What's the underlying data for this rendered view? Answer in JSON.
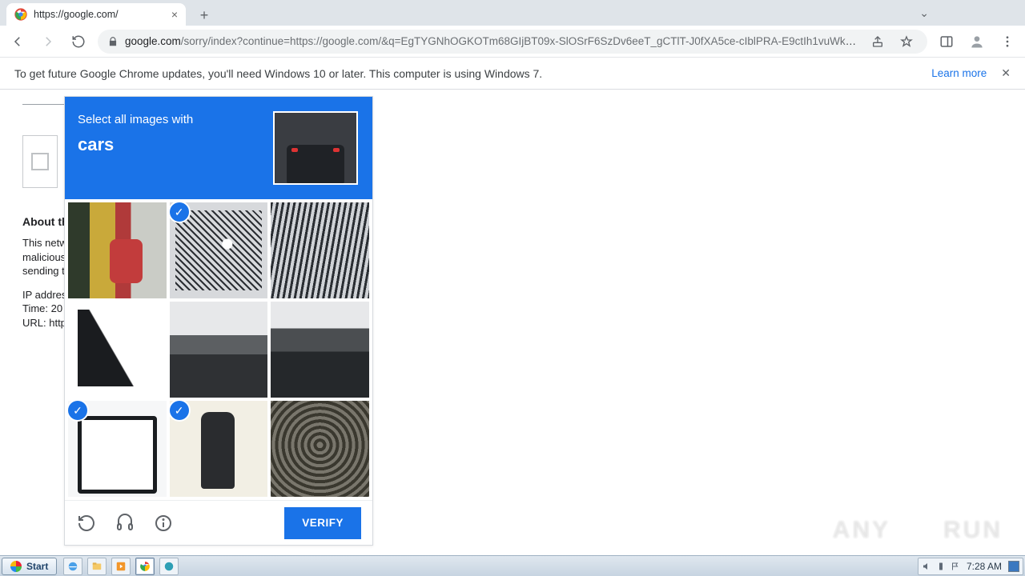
{
  "browser": {
    "tab_title": "https://google.com/",
    "url_domain": "google.com",
    "url_rest": "/sorry/index?continue=https://google.com/&q=EgTYGNhOGKOTm68GIjBT09x-SlOSrF6SzDv6eeT_gCTlT-J0fXA5ce-cIblPRA-E9ctIh1vuWkHJsM..."
  },
  "infobar": {
    "message": "To get future Google Chrome updates, you'll need Windows 10 or later. This computer is using Windows 7.",
    "learn_more": "Learn more"
  },
  "behind": {
    "about_heading": "About th",
    "para": "This netw\nmalicious\nsending t",
    "meta1": "IP addres",
    "meta2": "Time: 20",
    "meta3": "URL: http"
  },
  "captcha": {
    "prompt_line": "Select all images with",
    "target": "cars",
    "verify_label": "VERIFY",
    "tiles": [
      {
        "selected": false
      },
      {
        "selected": true
      },
      {
        "selected": false
      },
      {
        "selected": false
      },
      {
        "selected": false
      },
      {
        "selected": false
      },
      {
        "selected": true
      },
      {
        "selected": true
      },
      {
        "selected": false
      }
    ]
  },
  "taskbar": {
    "start": "Start",
    "clock": "7:28 AM"
  },
  "watermark": {
    "left": "ANY",
    "right": "RUN"
  }
}
